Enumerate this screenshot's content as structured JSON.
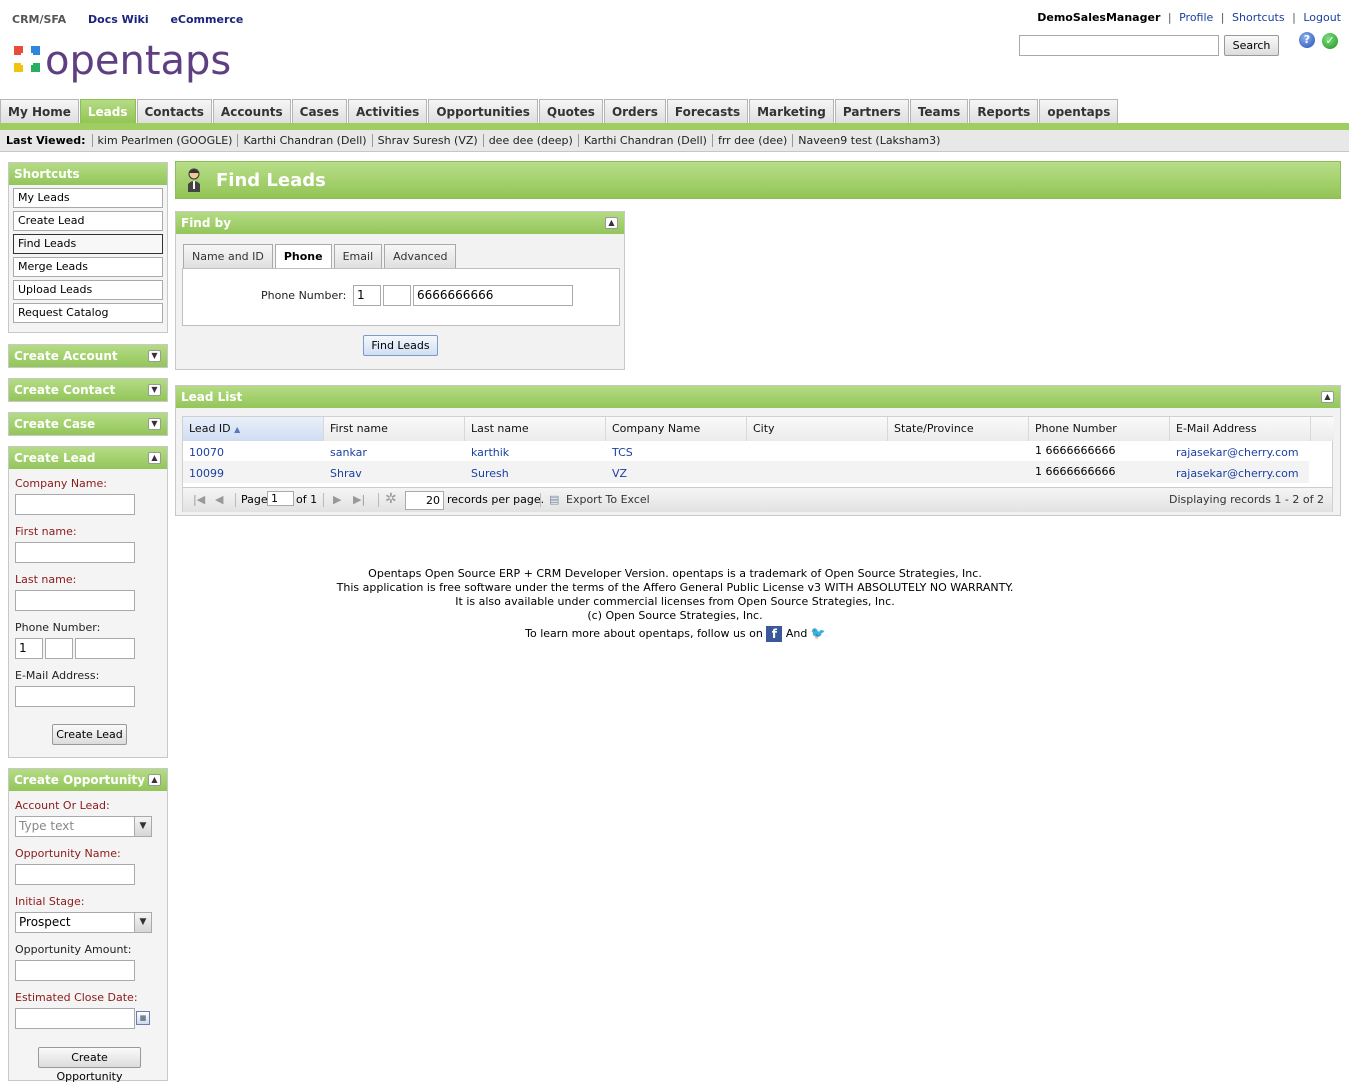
{
  "header": {
    "nav": [
      "CRM/SFA",
      "Docs Wiki",
      "eCommerce"
    ],
    "logo_text": "opentaps",
    "user": "DemoSalesManager",
    "user_links": [
      "Profile",
      "Shortcuts",
      "Logout"
    ],
    "search_value": "",
    "search_button": "Search"
  },
  "tabs": [
    "My Home",
    "Leads",
    "Contacts",
    "Accounts",
    "Cases",
    "Activities",
    "Opportunities",
    "Quotes",
    "Orders",
    "Forecasts",
    "Marketing",
    "Partners",
    "Teams",
    "Reports",
    "opentaps"
  ],
  "active_tab": "Leads",
  "last_viewed": {
    "label": "Last Viewed:",
    "items": [
      "kim Pearlmen (GOOGLE)",
      "Karthi Chandran (Dell)",
      "Shrav Suresh (VZ)",
      "dee dee (deep)",
      "Karthi Chandran (Dell)",
      "frr dee (dee)",
      "Naveen9 test (Laksham3)"
    ]
  },
  "sidebar": {
    "shortcuts_title": "Shortcuts",
    "shortcuts": [
      "My Leads",
      "Create Lead",
      "Find Leads",
      "Merge Leads",
      "Upload Leads",
      "Request Catalog"
    ],
    "create_account": "Create Account",
    "create_contact": "Create Contact",
    "create_case": "Create Case",
    "create_lead": {
      "title": "Create Lead",
      "company_label": "Company Name:",
      "first_label": "First name:",
      "last_label": "Last name:",
      "phone_label": "Phone Number:",
      "phone_country": "1",
      "email_label": "E-Mail Address:",
      "button": "Create Lead"
    },
    "create_opportunity": {
      "title": "Create Opportunity",
      "account_label": "Account Or Lead:",
      "account_placeholder": "Type text",
      "name_label": "Opportunity Name:",
      "stage_label": "Initial Stage:",
      "stage_value": "Prospect",
      "amount_label": "Opportunity Amount:",
      "close_label": "Estimated Close Date:",
      "button": "Create Opportunity"
    }
  },
  "main": {
    "title": "Find Leads",
    "find_by": {
      "title": "Find by",
      "tabs": [
        "Name and ID",
        "Phone",
        "Email",
        "Advanced"
      ],
      "active": "Phone",
      "phone_label": "Phone Number:",
      "country_code": "1",
      "area_code": "",
      "number": "6666666666",
      "button": "Find Leads"
    },
    "lead_list": {
      "title": "Lead List",
      "columns": [
        "Lead ID",
        "First name",
        "Last name",
        "Company Name",
        "City",
        "State/Province",
        "Phone Number",
        "E-Mail Address"
      ],
      "rows": [
        [
          "10070",
          "sankar",
          "karthik",
          "TCS",
          "",
          "",
          "1 6666666666",
          "rajasekar@cherry.com"
        ],
        [
          "10099",
          "Shrav",
          "Suresh",
          "VZ",
          "",
          "",
          "1 6666666666",
          "rajasekar@cherry.com"
        ]
      ],
      "pager": {
        "page_label": "Page",
        "page": "1",
        "of_label": "of 1",
        "per_page": "20",
        "per_page_label": "records per page.",
        "export": "Export To Excel",
        "display": "Displaying records 1 - 2 of 2"
      }
    }
  },
  "footer": {
    "line1": "Opentaps Open Source ERP + CRM Developer Version. opentaps is a trademark of Open Source Strategies, Inc.",
    "line2": "This application is free software under the terms of the Affero General Public License v3 WITH ABSOLUTELY NO WARRANTY.",
    "line3": "It is also available under commercial licenses from Open Source Strategies, Inc.",
    "line4": "(c) Open Source Strategies, Inc.",
    "line5_a": "To learn more about opentaps, follow us on",
    "line5_b": "And"
  },
  "colors": {
    "accent_green": "#9fcd62",
    "link_blue": "#1a3fa0",
    "required_red": "#8b1a1a"
  }
}
